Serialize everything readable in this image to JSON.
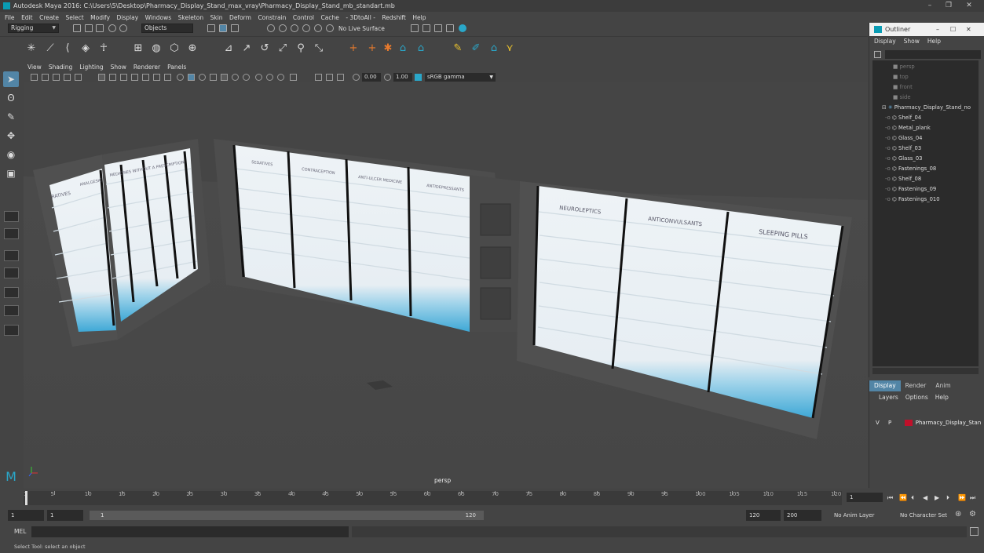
{
  "window": {
    "title": "Autodesk Maya 2016: C:\\Users\\5\\Desktop\\Pharmacy_Display_Stand_max_vray\\Pharmacy_Display_Stand_mb_standart.mb"
  },
  "menubar": [
    "File",
    "Edit",
    "Create",
    "Select",
    "Modify",
    "Display",
    "Windows",
    "Skeleton",
    "Skin",
    "Deform",
    "Constrain",
    "Control",
    "Cache",
    "- 3DtoAll -",
    "Redshift",
    "Help"
  ],
  "status_line": {
    "menu_set": "Rigging",
    "selection_mode": "Objects",
    "live_surface": "No Live Surface"
  },
  "viewport": {
    "menu": [
      "View",
      "Shading",
      "Lighting",
      "Show",
      "Renderer",
      "Panels"
    ],
    "gamma_value1": "0.00",
    "gamma_value2": "1.00",
    "color_space": "sRGB gamma",
    "camera_label": "persp",
    "scene_labels": {
      "left_unit": [
        "RATIVES",
        "ANALGESIC",
        "MEDICINES WITHOUT A PRESCRIPTION"
      ],
      "middle_unit": [
        "SEDATIVES",
        "CONTRACEPTION",
        "ANTI-ULCER MEDICINE",
        "ANTIDEPRESSANTS"
      ],
      "right_unit": [
        "NEUROLEPTICS",
        "ANTICONVULSANTS",
        "SLEEPING PILLS"
      ]
    }
  },
  "outliner": {
    "title": "Outliner",
    "menu": [
      "Display",
      "Show",
      "Help"
    ],
    "cameras": [
      "persp",
      "top",
      "front",
      "side"
    ],
    "group": "Pharmacy_Display_Stand_no",
    "children": [
      "Shelf_04",
      "Metal_plank",
      "Glass_04",
      "Shelf_03",
      "Glass_03",
      "Fastenings_08",
      "Shelf_08",
      "Fastenings_09",
      "Fastenings_010"
    ]
  },
  "layer_panel": {
    "tabs": [
      "Display",
      "Render",
      "Anim"
    ],
    "menu": [
      "Layers",
      "Options",
      "Help"
    ],
    "layer": {
      "v": "V",
      "p": "P",
      "name": "Pharmacy_Display_Stan",
      "color": "#c0102a"
    }
  },
  "timeline": {
    "ticks": [
      "1",
      "5",
      "10",
      "15",
      "20",
      "25",
      "30",
      "35",
      "40",
      "45",
      "50",
      "55",
      "60",
      "65",
      "70",
      "75",
      "80",
      "85",
      "90",
      "95",
      "100",
      "105",
      "110",
      "115",
      "120"
    ],
    "current_frame": "1"
  },
  "range": {
    "start": "1",
    "start_inner": "1",
    "slider_start": "1",
    "slider_end": "120",
    "end_inner": "120",
    "end": "200",
    "anim_layer": "No Anim Layer",
    "character_set": "No Character Set"
  },
  "command_line": {
    "label": "MEL"
  },
  "status": {
    "help_text": "Select Tool: select an object"
  }
}
